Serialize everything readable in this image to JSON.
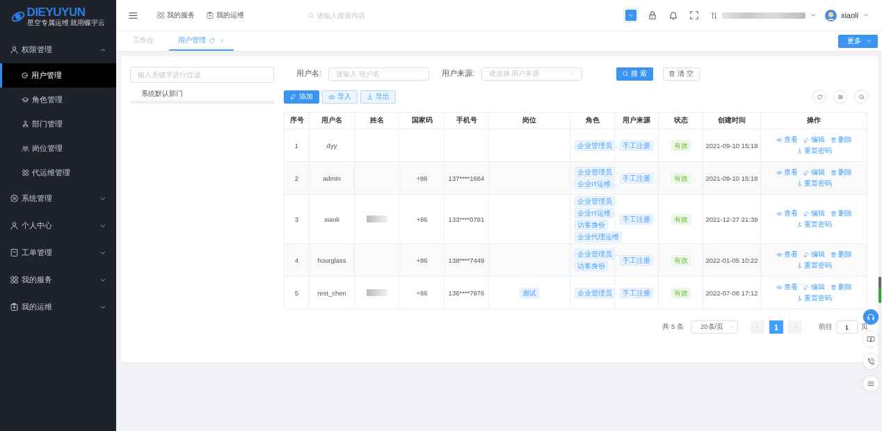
{
  "logo": {
    "name": "DIEYUYUN",
    "tagline": "星空专属运维 就用蝶宇云"
  },
  "sidebar": {
    "items": [
      {
        "label": "权限管理",
        "expanded": true,
        "children": [
          {
            "label": "用户管理",
            "selected": true
          },
          {
            "label": "角色管理",
            "selected": false
          },
          {
            "label": "部门管理",
            "selected": false
          },
          {
            "label": "岗位管理",
            "selected": false
          },
          {
            "label": "代运维管理",
            "selected": false
          }
        ]
      },
      {
        "label": "系统管理",
        "expanded": false
      },
      {
        "label": "个人中心",
        "expanded": false
      },
      {
        "label": "工单管理",
        "expanded": false
      },
      {
        "label": "我的服务",
        "expanded": false
      },
      {
        "label": "我的运维",
        "expanded": false
      }
    ]
  },
  "topbar": {
    "links": [
      "我的服务",
      "我的运维"
    ],
    "search": {
      "placeholder": "请输入搜索内容"
    },
    "user": "xiaoli"
  },
  "tabs": [
    {
      "label": "工作台",
      "selected": false,
      "closable": false
    },
    {
      "label": "用户管理",
      "selected": true,
      "closable": true
    }
  ],
  "more_button": "更多",
  "tree": {
    "placeholder": "输入关键字进行过滤",
    "nodes": [
      "系统默认部门"
    ]
  },
  "filters": [
    {
      "label": "用户名:",
      "kind": "input",
      "placeholder": "请输入 用户名"
    },
    {
      "label": "用户来源:",
      "kind": "select",
      "placeholder": "请选择 用户来源"
    }
  ],
  "search_button": "搜 索",
  "clear_button": "清 空",
  "toolbar": [
    {
      "label": "添加",
      "kind": "primary"
    },
    {
      "label": "导入",
      "kind": "plain"
    },
    {
      "label": "导出",
      "kind": "plain"
    }
  ],
  "table": {
    "columns": [
      "序号",
      "用户名",
      "姓名",
      "国家码",
      "手机号",
      "岗位",
      "角色",
      "用户来源",
      "状态",
      "创建时间",
      "操作"
    ],
    "rows": [
      {
        "index": "1",
        "username": "dyy",
        "name_redacted": false,
        "roles": [
          {
            "label": "企业管理员",
            "suffix": ".."
          }
        ],
        "source": "手工注册",
        "status": {
          "label": "有效",
          "kind": "success"
        },
        "created": "2021-09-10 15:18",
        "actions": [
          "查看",
          "编辑",
          "删除",
          "重置密码"
        ]
      },
      {
        "index": "2",
        "username": "admin",
        "name_redacted": false,
        "country_code": "+86",
        "phone": "137****1664",
        "roles": [
          {
            "label": "企业管理员",
            "suffix": ".."
          },
          {
            "label": "企业IT运维",
            "suffix": ".."
          }
        ],
        "source": "手工注册",
        "status": {
          "label": "有效",
          "kind": "success"
        },
        "created": "2021-09-10 15:18",
        "actions": [
          "查看",
          "编辑",
          "删除",
          "重置密码"
        ]
      },
      {
        "index": "3",
        "username": "xiaoli",
        "name_redacted": true,
        "country_code": "+86",
        "phone": "133****0781",
        "roles": [
          {
            "label": "企业管理员",
            "suffix": ".."
          },
          {
            "label": "企业IT运维",
            "suffix": ".."
          },
          {
            "label": "访客身份"
          },
          {
            "label": "企业代理运维"
          }
        ],
        "source": "手工注册",
        "status": {
          "label": "有效",
          "kind": "success"
        },
        "created": "2021-12-27 21:39",
        "actions": [
          "查看",
          "编辑",
          "删除",
          "重置密码"
        ]
      },
      {
        "index": "4",
        "username": "hourglass",
        "name_redacted": false,
        "country_code": "+86",
        "phone": "138****7449",
        "roles": [
          {
            "label": "企业管理员",
            "suffix": ".."
          },
          {
            "label": "访客身份"
          }
        ],
        "source": "手工注册",
        "status": {
          "label": "有效",
          "kind": "success"
        },
        "created": "2022-01-05 10:22",
        "actions": [
          "查看",
          "编辑",
          "删除",
          "重置密码"
        ]
      },
      {
        "index": "5",
        "username": "rest_chen",
        "name_redacted": true,
        "country_code": "+86",
        "phone": "136****7976",
        "post": "测试",
        "roles": [
          {
            "label": "企业管理员",
            "suffix": ".."
          }
        ],
        "source": "手工注册",
        "status": {
          "label": "有效",
          "kind": "success"
        },
        "created": "2022-07-08 17:12",
        "actions": [
          "查看",
          "编辑",
          "删除",
          "重置密码"
        ]
      }
    ]
  },
  "pagination": {
    "total": "共 5 条",
    "page_size": "20条/页",
    "pages": [
      {
        "label": "1",
        "selected": true
      }
    ],
    "goto_label": "前往",
    "goto_value": "1",
    "goto_suffix": "页"
  }
}
